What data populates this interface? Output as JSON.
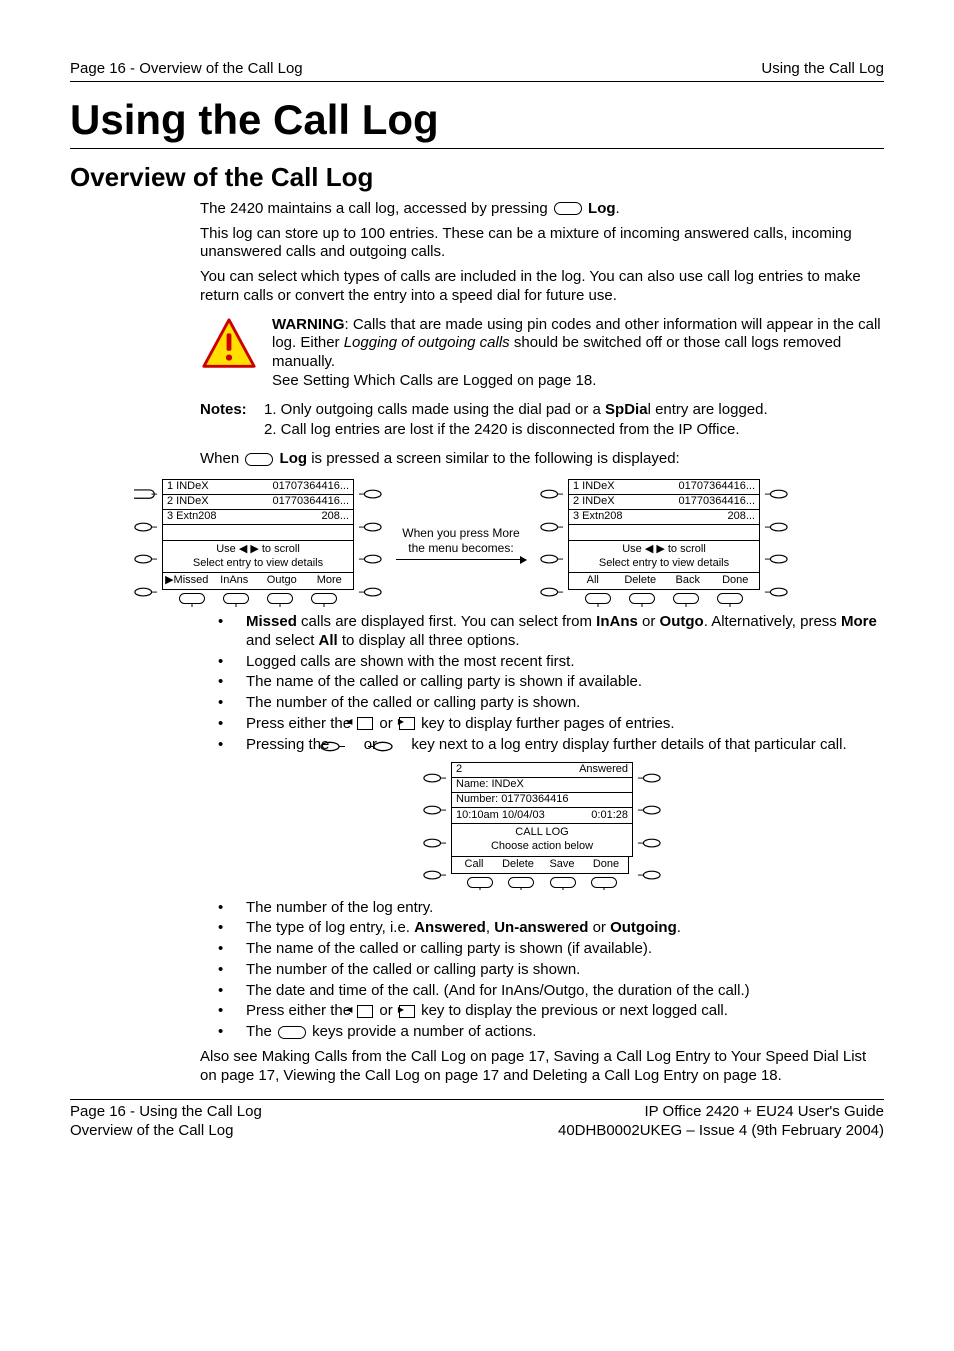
{
  "header": {
    "left": "Page 16 - Overview of the Call Log",
    "right": "Using the Call Log"
  },
  "title": "Using the Call Log",
  "subtitle": "Overview of the Call Log",
  "intro": {
    "p1_a": "The 2420 maintains a call log, accessed by pressing ",
    "p1_b_key": "Log",
    "p1_c": ".",
    "p2": "This log can store up to 100 entries. These can be a mixture of incoming answered calls, incoming unanswered calls and outgoing calls.",
    "p3": "You can select which types of calls are included in the log. You can also use call log entries to make return calls or convert the entry into a speed dial for future use."
  },
  "warning": {
    "label": "WARNING",
    "text_a": ": Calls that are made using pin codes and other information will appear in the call log. Either ",
    "italic": "Logging of outgoing calls",
    "text_b": " should be switched off or those call logs removed manually.",
    "see": "See Setting Which Calls are Logged on page 18."
  },
  "notes": {
    "label": "Notes:",
    "items": [
      {
        "pre": "Only outgoing calls made using the dial pad or a ",
        "bold": "SpDia",
        "post": "l entry are logged."
      },
      {
        "pre": "Call log entries are lost if the 2420 is disconnected from the IP Office.",
        "bold": "",
        "post": ""
      }
    ]
  },
  "when_line": {
    "a": "When ",
    "key": "Log",
    "b": " is pressed a screen similar to the following is displayed:"
  },
  "screen1": {
    "rows": [
      {
        "left": "1  INDeX",
        "right": "01707364416..."
      },
      {
        "left": "2  INDeX",
        "right": "01770364416..."
      },
      {
        "left": "3  Extn208",
        "right": "208..."
      },
      {
        "left": "",
        "right": ""
      }
    ],
    "help1": "Use ◀ ▶ to scroll",
    "help2": "Select entry to view details",
    "soft": [
      "▶Missed",
      "InAns",
      "Outgo",
      "More"
    ]
  },
  "between": {
    "line1": "When you press More",
    "line2": "the menu becomes:"
  },
  "screen2": {
    "rows": [
      {
        "left": "1  INDeX",
        "right": "01707364416..."
      },
      {
        "left": "2  INDeX",
        "right": "01770364416..."
      },
      {
        "left": "3  Extn208",
        "right": "208..."
      },
      {
        "left": "",
        "right": ""
      }
    ],
    "help1": "Use ◀ ▶ to scroll",
    "help2": "Select entry to view details",
    "soft": [
      "All",
      "Delete",
      "Back",
      "Done"
    ]
  },
  "bullets1": [
    {
      "parts": [
        {
          "b": "Missed"
        },
        {
          "t": " calls are displayed first. You can select from "
        },
        {
          "b": "InAns"
        },
        {
          "t": " or "
        },
        {
          "b": "Outgo"
        },
        {
          "t": ". Alternatively, press "
        },
        {
          "b": "More"
        },
        {
          "t": " and select "
        },
        {
          "b": "All"
        },
        {
          "t": " to display all three options."
        }
      ]
    },
    {
      "parts": [
        {
          "t": "Logged calls are shown with the most recent first."
        }
      ]
    },
    {
      "parts": [
        {
          "t": "The name of the called or calling party is shown if available."
        }
      ]
    },
    {
      "parts": [
        {
          "t": "The number of the called or calling party is shown."
        }
      ]
    },
    {
      "parts": [
        {
          "t": "Press either the "
        },
        {
          "lr": true
        },
        {
          "t": " key to display further pages of entries."
        }
      ]
    },
    {
      "parts": [
        {
          "t": "Pressing the "
        },
        {
          "softlr": true
        },
        {
          "t": " key next to a log entry display further details of that particular call."
        }
      ]
    }
  ],
  "detail_screen": {
    "rows": [
      {
        "left": "2",
        "right": "Answered"
      },
      {
        "left": "Name:   INDeX",
        "right": ""
      },
      {
        "left": "Number: 01770364416",
        "right": ""
      },
      {
        "left": "10:10am  10/04/03",
        "right": "0:01:28"
      }
    ],
    "help1": "CALL LOG",
    "help2": "Choose action below",
    "soft": [
      "Call",
      "Delete",
      "Save",
      "Done"
    ]
  },
  "bullets2": [
    {
      "parts": [
        {
          "t": "The number of the log entry."
        }
      ]
    },
    {
      "parts": [
        {
          "t": "The type of log entry, i.e. "
        },
        {
          "b": "Answered"
        },
        {
          "t": ", "
        },
        {
          "b": "Un-answered"
        },
        {
          "t": " or "
        },
        {
          "b": "Outgoing"
        },
        {
          "t": "."
        }
      ]
    },
    {
      "parts": [
        {
          "t": "The name of the called or calling party is shown (if available)."
        }
      ]
    },
    {
      "parts": [
        {
          "t": "The number of the called or calling party is shown."
        }
      ]
    },
    {
      "parts": [
        {
          "t": "The date and time of the call. (And for InAns/Outgo, the duration of the call.)"
        }
      ]
    },
    {
      "parts": [
        {
          "t": "Press either the "
        },
        {
          "lr": true
        },
        {
          "t": " key to display the previous or next logged call."
        }
      ]
    },
    {
      "parts": [
        {
          "t": "The "
        },
        {
          "oval": true
        },
        {
          "t": " keys provide a number of actions."
        }
      ]
    }
  ],
  "also_see": "Also see Making Calls from the Call Log on page 17, Saving a Call Log Entry to Your Speed Dial List on page 17, Viewing the Call Log on page 17 and Deleting a Call Log Entry on page 18.",
  "footer": {
    "left1": "Page 16 - Using the Call Log",
    "left2": "Overview of the Call Log",
    "right1": "IP Office 2420 + EU24 User's Guide",
    "right2": "40DHB0002UKEG – Issue 4 (9th February 2004)"
  }
}
